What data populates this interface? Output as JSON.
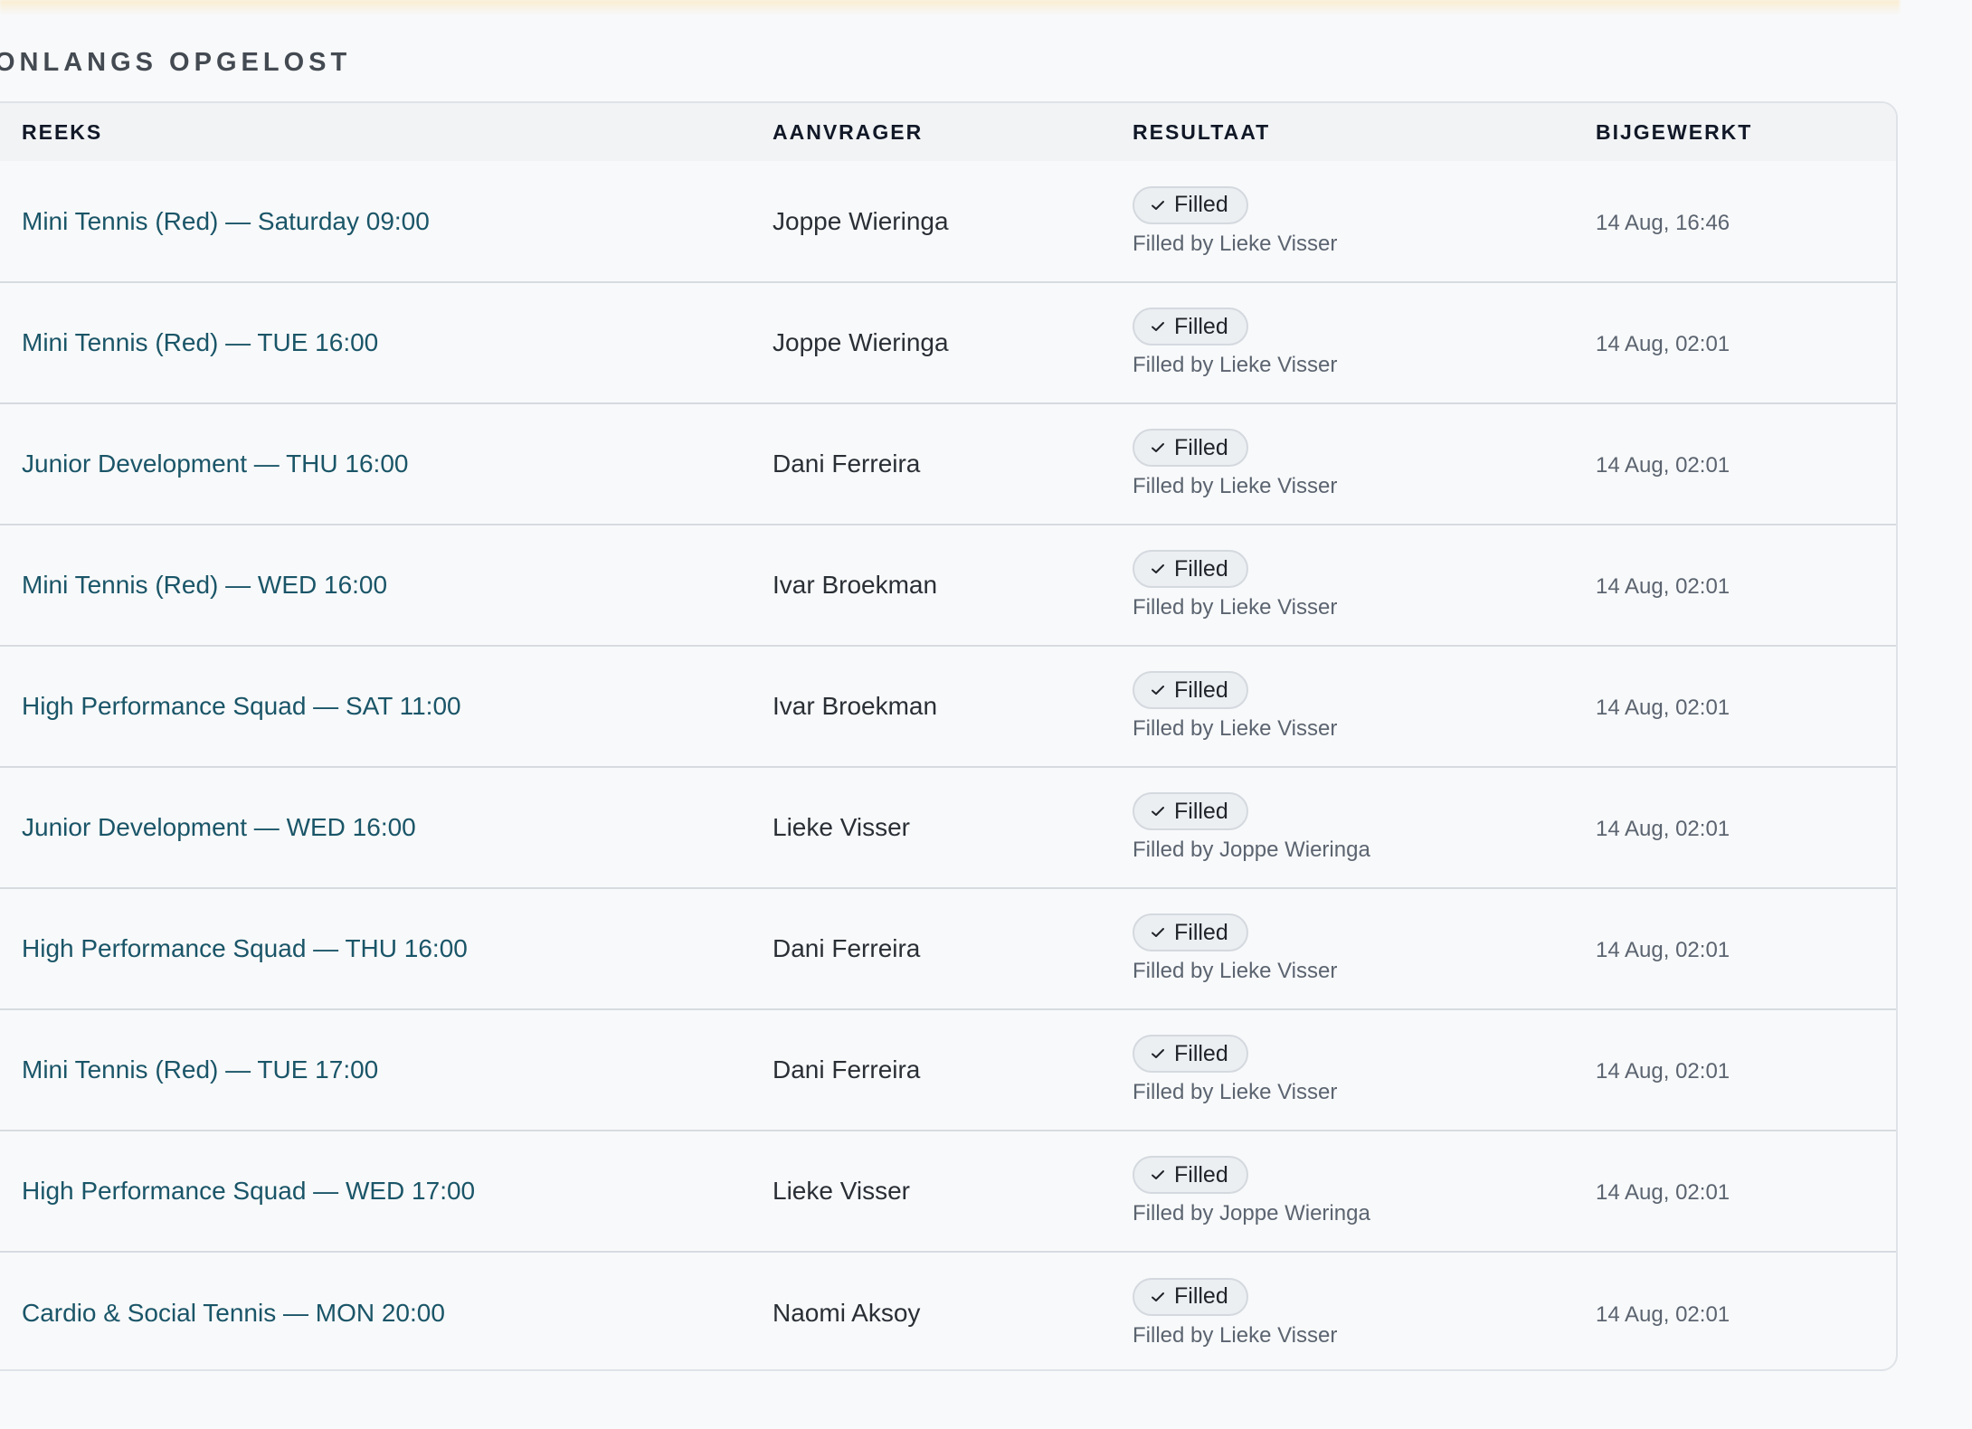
{
  "section": {
    "title": "ONLANGS OPGELOST"
  },
  "table": {
    "headers": {
      "series": "REEKS",
      "requester": "AANVRAGER",
      "result": "RESULTAAT",
      "updated": "BIJGEWERKT"
    },
    "rows": [
      {
        "series": "Mini Tennis (Red) — Saturday 09:00",
        "requester": "Joppe Wieringa",
        "result": "Filled",
        "filled_by": "Filled by Lieke Visser",
        "updated": "14 Aug, 16:46"
      },
      {
        "series": "Mini Tennis (Red) — TUE 16:00",
        "requester": "Joppe Wieringa",
        "result": "Filled",
        "filled_by": "Filled by Lieke Visser",
        "updated": "14 Aug, 02:01"
      },
      {
        "series": "Junior Development — THU 16:00",
        "requester": "Dani Ferreira",
        "result": "Filled",
        "filled_by": "Filled by Lieke Visser",
        "updated": "14 Aug, 02:01"
      },
      {
        "series": "Mini Tennis (Red) — WED 16:00",
        "requester": "Ivar Broekman",
        "result": "Filled",
        "filled_by": "Filled by Lieke Visser",
        "updated": "14 Aug, 02:01"
      },
      {
        "series": "High Performance Squad — SAT 11:00",
        "requester": "Ivar Broekman",
        "result": "Filled",
        "filled_by": "Filled by Lieke Visser",
        "updated": "14 Aug, 02:01"
      },
      {
        "series": "Junior Development — WED 16:00",
        "requester": "Lieke Visser",
        "result": "Filled",
        "filled_by": "Filled by Joppe Wieringa",
        "updated": "14 Aug, 02:01"
      },
      {
        "series": "High Performance Squad — THU 16:00",
        "requester": "Dani Ferreira",
        "result": "Filled",
        "filled_by": "Filled by Lieke Visser",
        "updated": "14 Aug, 02:01"
      },
      {
        "series": "Mini Tennis (Red) — TUE 17:00",
        "requester": "Dani Ferreira",
        "result": "Filled",
        "filled_by": "Filled by Lieke Visser",
        "updated": "14 Aug, 02:01"
      },
      {
        "series": "High Performance Squad — WED 17:00",
        "requester": "Lieke Visser",
        "result": "Filled",
        "filled_by": "Filled by Joppe Wieringa",
        "updated": "14 Aug, 02:01"
      },
      {
        "series": "Cardio & Social Tennis — MON 20:00",
        "requester": "Naomi Aksoy",
        "result": "Filled",
        "filled_by": "Filled by Lieke Visser",
        "updated": "14 Aug, 02:01"
      }
    ]
  },
  "icons": {
    "status": "check-icon"
  },
  "colors": {
    "background": "#f8f9fa",
    "link": "#1a5568",
    "header_background": "#f1f3f5",
    "badge_background": "#eceff2",
    "border": "#dfe3e8"
  }
}
